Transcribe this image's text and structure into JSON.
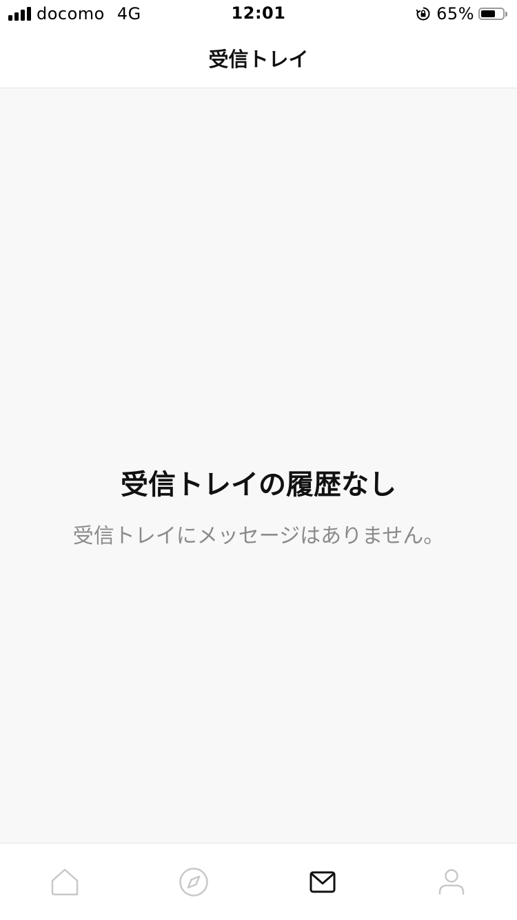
{
  "status_bar": {
    "carrier": "docomo",
    "network": "4G",
    "time": "12:01",
    "battery_percent_text": "65%",
    "battery_level": 0.65,
    "signal_bars": 4
  },
  "header": {
    "title": "受信トレイ"
  },
  "empty_state": {
    "title": "受信トレイの履歴なし",
    "description": "受信トレイにメッセージはありません。"
  },
  "tab_bar": {
    "tabs": [
      {
        "icon": "home-icon",
        "active": false
      },
      {
        "icon": "compass-icon",
        "active": false
      },
      {
        "icon": "mail-icon",
        "active": true
      },
      {
        "icon": "profile-icon",
        "active": false
      }
    ],
    "active_color": "#111111",
    "inactive_color": "#c8c8c8"
  },
  "colors": {
    "background": "#f8f8f8",
    "header_background": "#ffffff",
    "divider": "#e3e3e3",
    "secondary_text": "#8a8a8a"
  }
}
